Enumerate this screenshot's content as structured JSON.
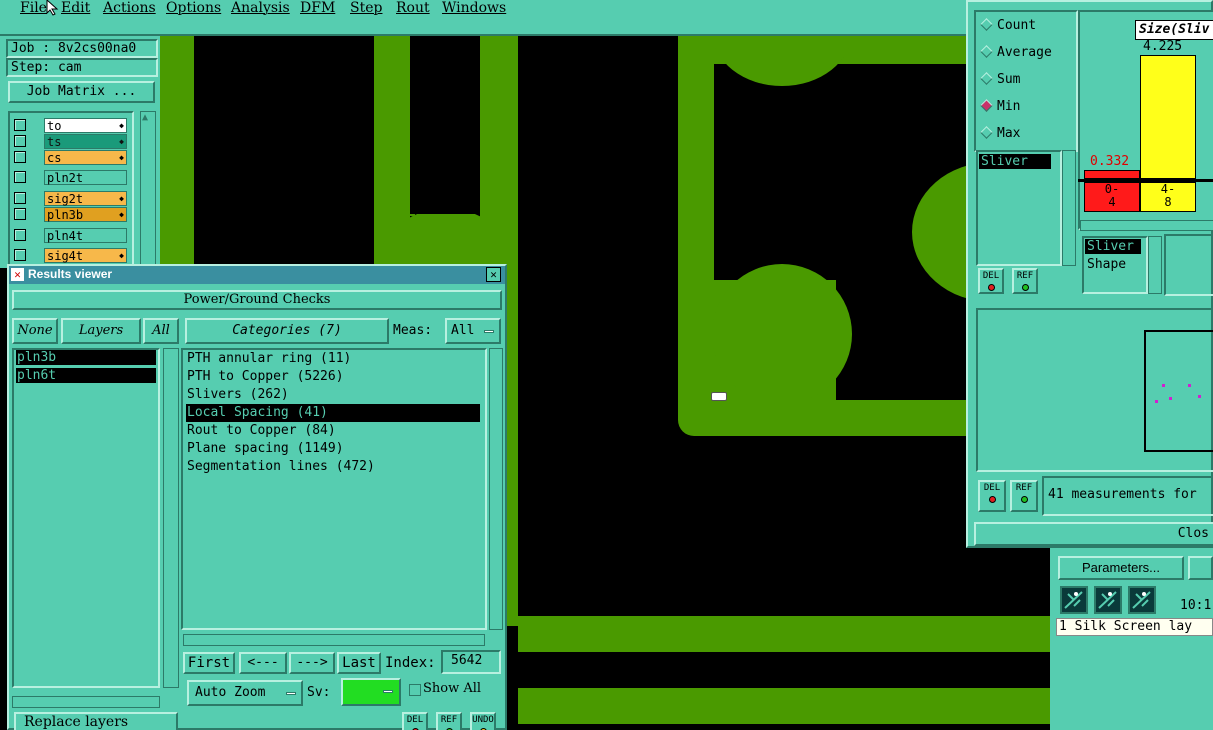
{
  "menubar": {
    "items": [
      "File",
      "Edit",
      "Actions",
      "Options",
      "Analysis",
      "DFM",
      "Step",
      "Rout",
      "Windows"
    ]
  },
  "job_panel": {
    "job_label": "Job : 8v2cs00na0",
    "step_label": "Step: cam",
    "job_matrix_button": "Job Matrix ...",
    "layers": [
      {
        "name": "to",
        "color": "#ffffff",
        "mark": "◆"
      },
      {
        "name": "ts",
        "color": "#1a9a7a",
        "mark": "◆"
      },
      {
        "name": "cs",
        "color": "#f7b84a",
        "mark": "◆"
      },
      {
        "name": "pln2t",
        "color": "#56cdb0",
        "mark": ""
      },
      {
        "name": "sig2t",
        "color": "#f7b84a",
        "mark": "◆"
      },
      {
        "name": "pln3b",
        "color": "#e0a020",
        "mark": "◆"
      },
      {
        "name": "pln4t",
        "color": "#56cdb0",
        "mark": ""
      },
      {
        "name": "sig4t",
        "color": "#f7b84a",
        "mark": "◆"
      }
    ]
  },
  "results_viewer": {
    "title": "Results viewer",
    "close_glyph": "✕",
    "header": "Power/Ground Checks",
    "none_btn": "None",
    "layers_btn": "Layers",
    "all_btn": "All",
    "categories_btn": "Categories (7)",
    "meas_label": "Meas:",
    "meas_value": "All",
    "layer_list": [
      "pln3b",
      "pln6t"
    ],
    "categories": [
      "PTH annular ring (11)",
      "PTH to Copper (5226)",
      "Slivers (262)",
      "Local Spacing (41)",
      "Rout to Copper (84)",
      "Plane spacing (1149)",
      "Segmentation lines (472)"
    ],
    "selected_category": 3,
    "first_btn": "First",
    "prev_btn": "<---",
    "next_btn": "--->",
    "last_btn": "Last",
    "index_label": "Index:",
    "index_value": "5642",
    "auto_zoom": "Auto Zoom",
    "sv_label": "Sv:",
    "show_all": "Show All",
    "replace_layers": "Replace layers",
    "del": "DEL",
    "ref": "REF",
    "undo": "UNDO"
  },
  "stats_panel": {
    "radios": [
      "Count",
      "Average",
      "Sum",
      "Min",
      "Max"
    ],
    "selected_radio": "Min",
    "list_item": "Sliver",
    "histogram_title": "Size(Sliv",
    "bar1_value": "0.332",
    "bar2_value": "4.225",
    "bin1_label": [
      "0-",
      "4"
    ],
    "bin2_label": [
      "4-",
      "8"
    ],
    "lower_list": [
      "Sliver",
      "Shape"
    ],
    "measurements_text": "41 measurements for",
    "close_btn": "Clos",
    "del": "DEL",
    "ref": "REF"
  },
  "bottom_right": {
    "parameters_btn": "Parameters...",
    "time": "10:1",
    "status": "1 Silk Screen lay"
  },
  "colors": {
    "panel": "#56cdb0",
    "copper": "#4a9a00",
    "bar_red": "#ff1a1a",
    "bar_yellow": "#ffff1a"
  }
}
